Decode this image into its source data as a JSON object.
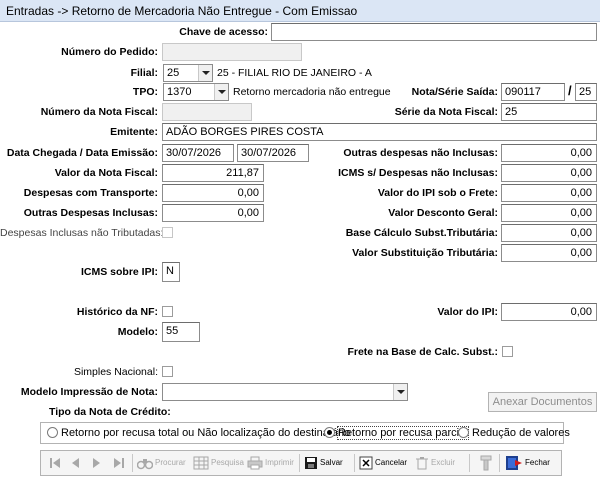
{
  "window": {
    "title": "Entradas -> Retorno de Mercadoria Não Entregue - Com Emissao"
  },
  "form": {
    "chave_acesso": {
      "label": "Chave de acesso:",
      "value": ""
    },
    "numero_pedido": {
      "label": "Número do Pedido:",
      "value": ""
    },
    "filial": {
      "label": "Filial:",
      "code": "25",
      "desc": "25 - FILIAL RIO DE JANEIRO - A"
    },
    "tpo": {
      "label": "TPO:",
      "code": "1370",
      "desc": "Retorno mercadoria não entregue"
    },
    "nota_serie_saida": {
      "label": "Nota/Série Saída:",
      "nota": "090117",
      "separator": "/",
      "serie": "25"
    },
    "numero_nota_fiscal": {
      "label": "Número da Nota Fiscal:",
      "value": ""
    },
    "serie_nota_fiscal": {
      "label": "Série da Nota Fiscal:",
      "value": "25"
    },
    "emitente": {
      "label": "Emitente:",
      "value": "ADÃO BORGES PIRES COSTA"
    },
    "data_chegada_emissao": {
      "label": "Data Chegada / Data Emissão:",
      "chegada": "30/07/2026",
      "emissao": "30/07/2026"
    },
    "outras_despesas_nao_inclusas": {
      "label": "Outras despesas não Inclusas:",
      "value": "0,00"
    },
    "valor_nota_fiscal": {
      "label": "Valor da Nota Fiscal:",
      "value": "211,87"
    },
    "icms_despesas_nao_inclusas": {
      "label": "ICMS s/ Despesas não Inclusas:",
      "value": "0,00"
    },
    "despesas_transporte": {
      "label": "Despesas com Transporte:",
      "value": "0,00"
    },
    "valor_ipi_frete": {
      "label": "Valor do IPI sob o Frete:",
      "value": "0,00"
    },
    "outras_despesas_inclusas": {
      "label": "Outras Despesas Inclusas:",
      "value": "0,00"
    },
    "valor_desconto_geral": {
      "label": "Valor Desconto Geral:",
      "value": "0,00"
    },
    "despesas_inclusas_nao_tributadas": {
      "label": "Despesas Inclusas não Tributadas:"
    },
    "base_calculo_subst": {
      "label": "Base Cálculo Subst.Tributária:",
      "value": "0,00"
    },
    "valor_substituicao": {
      "label": "Valor Substituição Tributária:",
      "value": "0,00"
    },
    "icms_sobre_ipi": {
      "label": "ICMS sobre IPI:",
      "value": "N"
    },
    "historico_nf": {
      "label": "Histórico da NF:"
    },
    "valor_ipi": {
      "label": "Valor do IPI:",
      "value": "0,00"
    },
    "modelo": {
      "label": "Modelo:",
      "value": "55"
    },
    "frete_base_calc": {
      "label": "Frete na Base de Calc. Subst.:"
    },
    "simples_nacional": {
      "label": "Simples Nacional:"
    },
    "modelo_impressao": {
      "label": "Modelo Impressão de Nota:",
      "value": ""
    },
    "anexar_documentos": {
      "label": "Anexar Documentos"
    },
    "tipo_nota_credito": {
      "label": "Tipo da Nota de Crédito:",
      "options": [
        {
          "label": "Retorno por recusa total ou Não localização do destinatário",
          "selected": false
        },
        {
          "label": "Retorno por recusa parcial",
          "selected": true
        },
        {
          "label": "Redução de valores",
          "selected": false
        }
      ]
    }
  },
  "toolbar": {
    "procurar": "Procurar",
    "pesquisa": "Pesquisa",
    "imprimir": "Imprimir",
    "salvar": "Salvar",
    "cancelar": "Cancelar",
    "excluir": "Excluir",
    "fechar": "Fechar"
  },
  "colors": {
    "titlebar": "#dbe6f5",
    "window_bg": "#ffffff",
    "disabled_text": "#a8a8a8"
  }
}
